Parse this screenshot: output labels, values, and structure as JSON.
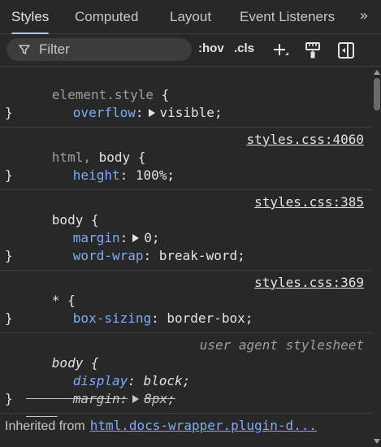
{
  "tabs": [
    {
      "label": "Styles",
      "active": true
    },
    {
      "label": "Computed",
      "active": false
    },
    {
      "label": "Layout",
      "active": false
    },
    {
      "label": "Event Listeners",
      "active": false
    }
  ],
  "more_tabs_icon": "chevron-double-right-icon",
  "toolbar": {
    "filter_placeholder": "Filter",
    "hov_label": ":hov",
    "cls_label": ".cls",
    "icons": [
      "filter-icon",
      "add-rule-icon",
      "paint-brush-icon",
      "toggle-sidebar-icon"
    ]
  },
  "rules": {
    "element_style": {
      "selector": "element.style",
      "prop": "overflow",
      "value": "visible"
    },
    "html_body": {
      "selector_a": "html",
      "selector_b": "body",
      "source": "styles.css:4060",
      "prop": "height",
      "value": "100%;"
    },
    "body": {
      "selector": "body",
      "source": "styles.css:385",
      "prop1": "margin",
      "value1": "0;",
      "prop2": "word-wrap",
      "value2": "break-word;"
    },
    "universal": {
      "selector": "*",
      "source": "styles.css:369",
      "prop": "box-sizing",
      "value": "border-box;"
    },
    "ua_body": {
      "selector": "body",
      "source": "user agent stylesheet",
      "prop1": "display",
      "value1": "block;",
      "prop2": "margin",
      "value2": "8px;"
    }
  },
  "inherited": {
    "label": "Inherited from",
    "link": "html.docs-wrapper.plugin-d..."
  },
  "colors": {
    "background": "#282828",
    "property": "#7cacf8",
    "accent": "#a8c7fa"
  }
}
